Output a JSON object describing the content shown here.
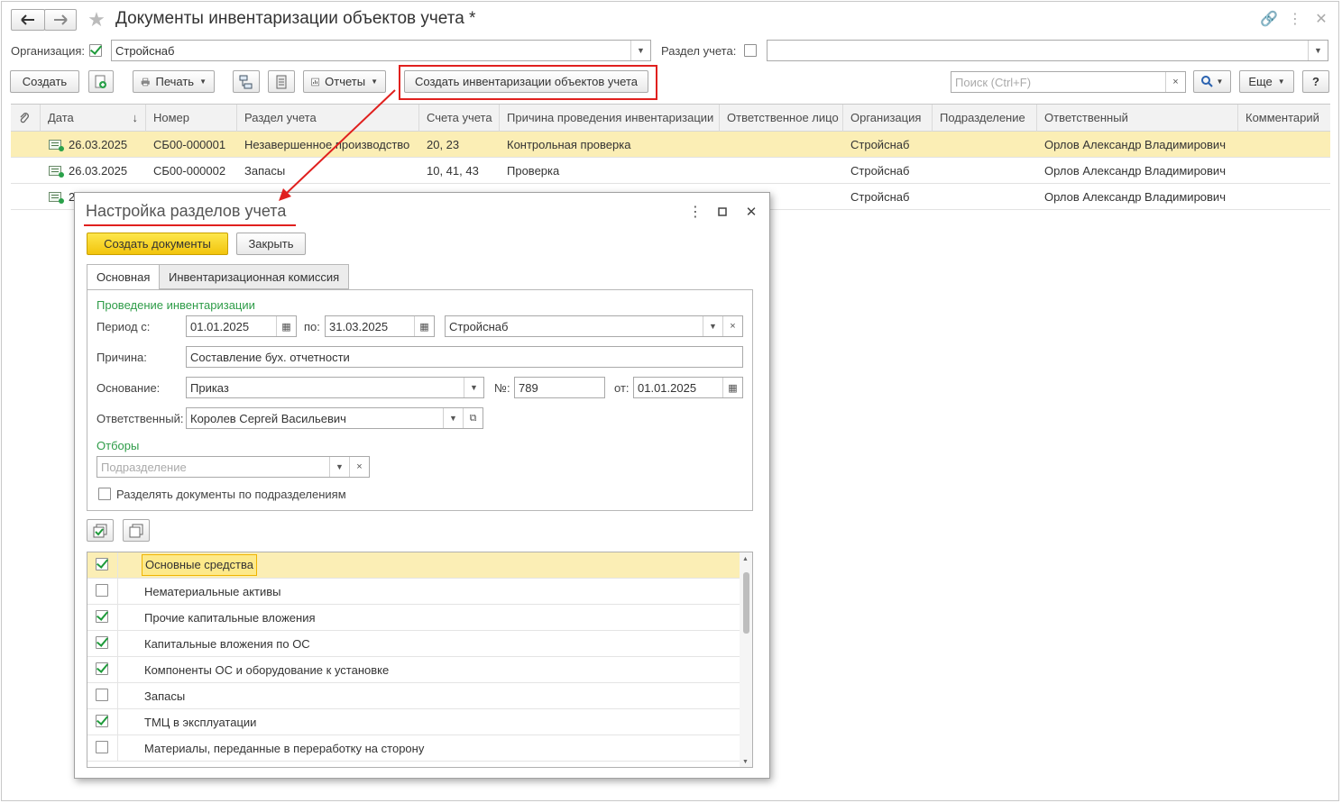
{
  "window": {
    "title": "Документы инвентаризации объектов учета *"
  },
  "filters": {
    "org_label": "Организация:",
    "org_value": "Стройснаб",
    "section_label": "Раздел учета:",
    "section_value": ""
  },
  "toolbar": {
    "create": "Создать",
    "print": "Печать",
    "reports": "Отчеты",
    "create_inventory": "Создать инвентаризации объектов учета",
    "search_placeholder": "Поиск (Ctrl+F)",
    "more": "Еще",
    "help": "?"
  },
  "table": {
    "headers": [
      "Дата",
      "Номер",
      "Раздел учета",
      "Счета учета",
      "Причина проведения инвентаризации",
      "Ответственное лицо",
      "Организация",
      "Подразделение",
      "Ответственный",
      "Комментарий"
    ],
    "rows": [
      {
        "date": "26.03.2025",
        "number": "СБ00-000001",
        "section": "Незавершенное производство",
        "accounts": "20, 23",
        "reason": "Контрольная проверка",
        "person": "",
        "org": "Стройснаб",
        "dept": "",
        "responsible": "Орлов Александр Владимирович",
        "comment": ""
      },
      {
        "date": "26.03.2025",
        "number": "СБ00-000002",
        "section": "Запасы",
        "accounts": "10, 41, 43",
        "reason": "Проверка",
        "person": "",
        "org": "Стройснаб",
        "dept": "",
        "responsible": "Орлов Александр Владимирович",
        "comment": ""
      },
      {
        "date": "2",
        "number": "",
        "section": "",
        "accounts": "",
        "reason": "",
        "person": "",
        "org": "Стройснаб",
        "dept": "",
        "responsible": "Орлов Александр Владимирович",
        "comment": ""
      }
    ]
  },
  "modal": {
    "title": "Настройка разделов учета",
    "create_docs": "Создать документы",
    "close": "Закрыть",
    "tabs": [
      "Основная",
      "Инвентаризационная комиссия"
    ],
    "section_inventory": "Проведение инвентаризации",
    "period_label": "Период с:",
    "period_from": "01.01.2025",
    "to_label": "по:",
    "period_to": "31.03.2025",
    "org_value": "Стройснаб",
    "reason_label": "Причина:",
    "reason_value": "Составление бух. отчетности",
    "basis_label": "Основание:",
    "basis_value": "Приказ",
    "num_label": "№:",
    "num_value": "789",
    "from_label": "от:",
    "from_value": "01.01.2025",
    "responsible_label": "Ответственный:",
    "responsible_value": "Королев Сергей Васильевич",
    "section_filters": "Отборы",
    "dept_placeholder": "Подразделение",
    "split_label": "Разделять документы по подразделениям",
    "items": [
      {
        "label": "Основные средства",
        "checked": true
      },
      {
        "label": "Нематериальные активы",
        "checked": false
      },
      {
        "label": "Прочие капитальные вложения",
        "checked": true
      },
      {
        "label": "Капитальные вложения по ОС",
        "checked": true
      },
      {
        "label": "Компоненты ОС и оборудование к установке",
        "checked": true
      },
      {
        "label": "Запасы",
        "checked": false
      },
      {
        "label": "ТМЦ в эксплуатации",
        "checked": true
      },
      {
        "label": "Материалы, переданные в переработку на сторону",
        "checked": false
      }
    ]
  },
  "colors": {
    "accent_red": "#e0201e",
    "selection": "#fbeeb5",
    "green": "#2e9c48",
    "yellow_btn": "#f5cc1b"
  }
}
